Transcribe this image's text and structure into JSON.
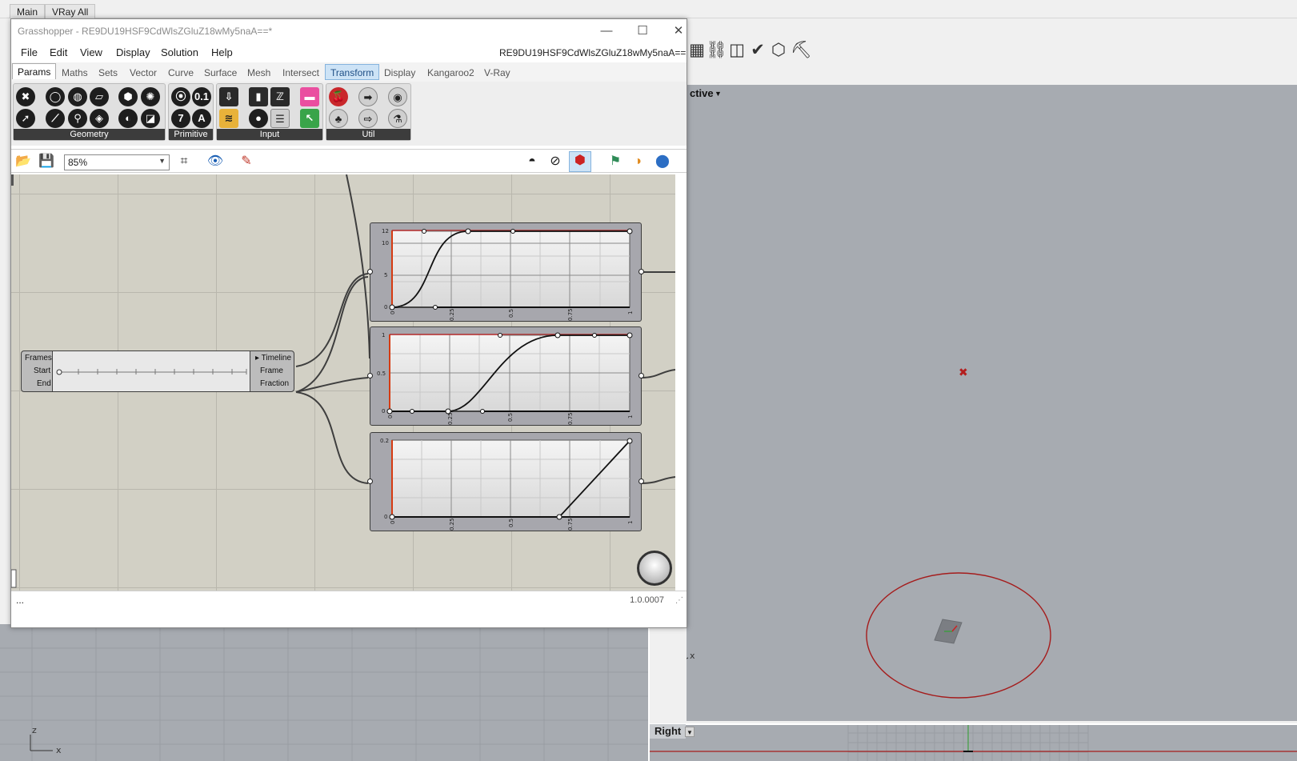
{
  "rhino": {
    "tabs": [
      "Main",
      "VRay All"
    ],
    "perspective_label": "ctive",
    "right_view_label": "Right",
    "toolbar_icons": [
      "grid-icon",
      "chart-icon",
      "fence-icon",
      "check-icon",
      "box-icon",
      "paint-icon"
    ]
  },
  "grasshopper": {
    "title": "Grasshopper - RE9DU19HSF9CdWlsZGluZ18wMy5naA==*",
    "doc_name": "RE9DU19HSF9CdWlsZGluZ18wMy5naA==",
    "window_buttons": {
      "minimize": "—",
      "maximize": "☐",
      "close": "✕"
    },
    "menu": [
      "File",
      "Edit",
      "View",
      "Display",
      "Solution",
      "Help"
    ],
    "tabs": [
      "Params",
      "Maths",
      "Sets",
      "Vector",
      "Curve",
      "Surface",
      "Mesh",
      "Intersect",
      "Transform",
      "Display",
      "Kangaroo2",
      "V-Ray"
    ],
    "active_tab": "Params",
    "panels": [
      "Geometry",
      "Primitive",
      "Input",
      "Util"
    ],
    "zoom": "85%",
    "status_left": "...",
    "version": "1.0.0007",
    "timeline": {
      "inputs": [
        "Frames",
        "Start",
        "End"
      ],
      "outputs": [
        "Timeline",
        "Frame",
        "Fraction"
      ]
    },
    "graph1": {
      "ymax": "12",
      "ymid": "10",
      "y5": "5",
      "y0": "0",
      "xticks": [
        "0",
        "0.25",
        "0.5",
        "0.75",
        "1"
      ]
    },
    "graph2": {
      "ymax": "1",
      "ymid": "0.5",
      "y0": "0",
      "xticks": [
        "0",
        "0.25",
        "0.5",
        "0.75",
        "1"
      ]
    },
    "graph3": {
      "ymax": "0.2",
      "y0": "0",
      "xticks": [
        "0",
        "0.25",
        "0.5",
        "0.75",
        "1"
      ]
    }
  }
}
